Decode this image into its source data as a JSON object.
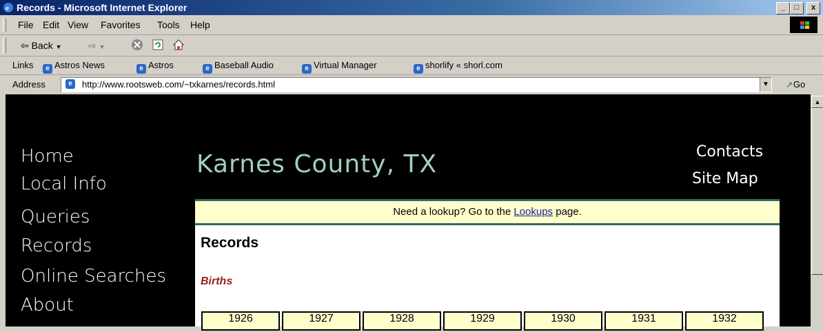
{
  "window": {
    "title": "Records - Microsoft Internet Explorer"
  },
  "menu": [
    "File",
    "Edit",
    "View",
    "Favorites",
    "Tools",
    "Help"
  ],
  "toolbar": {
    "back_label": "Back"
  },
  "links_bar": {
    "label": "Links",
    "items": [
      "Astros News",
      "Astros",
      "Baseball Audio",
      "Virtual Manager",
      "shorlify « shorl.com"
    ]
  },
  "address_bar": {
    "label": "Address",
    "url": "http://www.rootsweb.com/~txkarnes/records.html",
    "go_label": "Go"
  },
  "page": {
    "nav": [
      "Home",
      "Local Info",
      "Queries",
      "Records",
      "Online Searches",
      "About"
    ],
    "site_title": "Karnes County, TX",
    "top_links": [
      "Contacts",
      "Site Map"
    ],
    "lookup": {
      "prefix": "Need a lookup? Go to the ",
      "link": "Lookups",
      "suffix": " page."
    },
    "heading": "Records",
    "section": "Births",
    "years": [
      "1926",
      "1927",
      "1928",
      "1929",
      "1930",
      "1931",
      "1932"
    ]
  },
  "colors": {
    "accent_title": "#9fd0c4",
    "births_red": "#9b1c1c",
    "highlight_bg": "#ffffcc"
  }
}
